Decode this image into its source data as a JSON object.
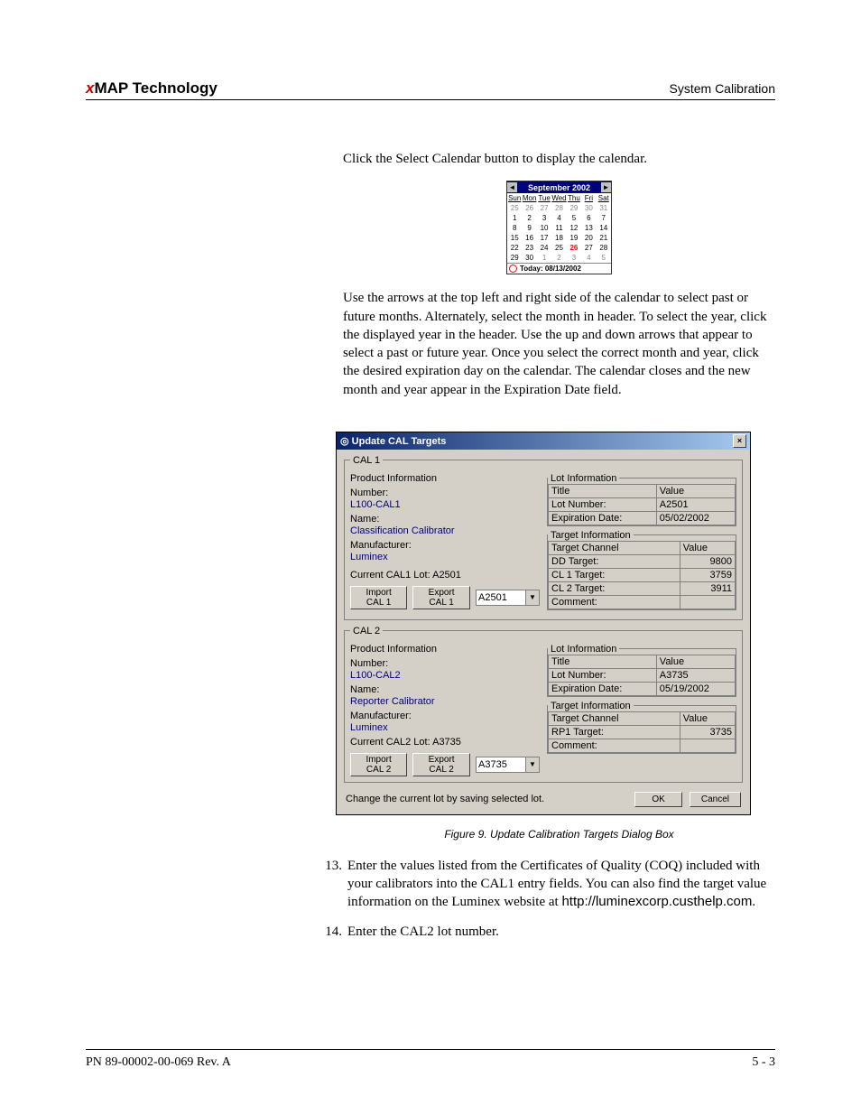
{
  "header": {
    "brand_x": "x",
    "brand_rest": "MAP Technology",
    "section": "System Calibration"
  },
  "paragraphs": {
    "p1": "Click the Select Calendar button to display the calendar.",
    "p2": "Use the arrows at the top left and right side of the calendar to select past or future months. Alternately, select the month in header. To select the year, click the displayed year in the header. Use the up and down arrows that appear to select a past or future year. Once you select the correct month and year, click the desired expiration day on the calendar. The calendar closes and the new month and year appear in the Expiration Date field."
  },
  "calendar": {
    "title": "September 2002",
    "day_headers": [
      "Sun",
      "Mon",
      "Tue",
      "Wed",
      "Thu",
      "Fri",
      "Sat"
    ],
    "rows": [
      [
        "25",
        "26",
        "27",
        "28",
        "29",
        "30",
        "31"
      ],
      [
        "1",
        "2",
        "3",
        "4",
        "5",
        "6",
        "7"
      ],
      [
        "8",
        "9",
        "10",
        "11",
        "12",
        "13",
        "14"
      ],
      [
        "15",
        "16",
        "17",
        "18",
        "19",
        "20",
        "21"
      ],
      [
        "22",
        "23",
        "24",
        "25",
        "26",
        "27",
        "28"
      ],
      [
        "29",
        "30",
        "1",
        "2",
        "3",
        "4",
        "5"
      ]
    ],
    "today_label": "Today: 08/13/2002"
  },
  "dialog": {
    "title": "Update CAL Targets",
    "cal1": {
      "legend": "CAL 1",
      "product_legend": "Product Information",
      "number_label": "Number:",
      "number_value": "L100-CAL1",
      "name_label": "Name:",
      "name_value": "Classification Calibrator",
      "manufacturer_label": "Manufacturer:",
      "manufacturer_value": "Luminex",
      "current_lot_label": "Current CAL1 Lot:  A2501",
      "import_btn": "Import CAL 1",
      "export_btn": "Export CAL 1",
      "dropdown_value": "A2501",
      "lot_legend": "Lot Information",
      "lot_cols": [
        "Title",
        "Value"
      ],
      "lot_rows": [
        [
          "Lot Number:",
          "A2501"
        ],
        [
          "Expiration Date:",
          "05/02/2002"
        ]
      ],
      "target_legend": "Target Information",
      "target_cols": [
        "Target Channel",
        "Value"
      ],
      "target_rows": [
        [
          "DD Target:",
          "9800"
        ],
        [
          "CL 1 Target:",
          "3759"
        ],
        [
          "CL 2 Target:",
          "3911"
        ],
        [
          "Comment:",
          ""
        ]
      ]
    },
    "cal2": {
      "legend": "CAL 2",
      "product_legend": "Product Information",
      "number_label": "Number:",
      "number_value": "L100-CAL2",
      "name_label": "Name:",
      "name_value": "Reporter Calibrator",
      "manufacturer_label": "Manufacturer:",
      "manufacturer_value": "Luminex",
      "current_lot_label": "Current CAL2 Lot:   A3735",
      "import_btn": "Import CAL 2",
      "export_btn": "Export CAL 2",
      "dropdown_value": "A3735",
      "lot_legend": "Lot Information",
      "lot_cols": [
        "Title",
        "Value"
      ],
      "lot_rows": [
        [
          "Lot Number:",
          "A3735"
        ],
        [
          "Expiration Date:",
          "05/19/2002"
        ]
      ],
      "target_legend": "Target Information",
      "target_cols": [
        "Target Channel",
        "Value"
      ],
      "target_rows": [
        [
          "RP1 Target:",
          "3735"
        ],
        [
          "Comment:",
          ""
        ]
      ]
    },
    "footer_note": "Change the current lot by saving selected lot.",
    "ok": "OK",
    "cancel": "Cancel"
  },
  "figure_caption": "Figure 9.  Update Calibration Targets Dialog Box",
  "steps": {
    "s13_num": "13.",
    "s13": "Enter the values listed from the Certificates of Quality (COQ) included with your calibrators into the CAL1 entry fields. You can also find the target value information on the Luminex website at ",
    "s13_url": "http://luminexcorp.custhelp.com",
    "s13_tail": ".",
    "s14_num": "14.",
    "s14": "Enter the CAL2 lot number."
  },
  "footer": {
    "left": "PN 89-00002-00-069 Rev. A",
    "right": "5 - 3"
  }
}
